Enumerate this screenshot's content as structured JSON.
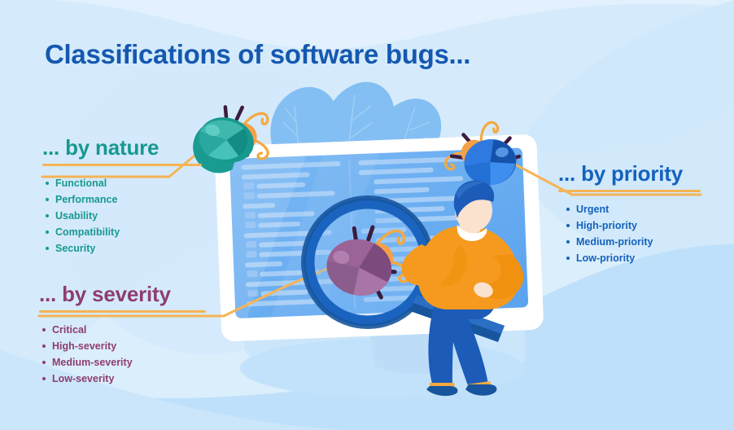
{
  "page": {
    "title": "Classifications of software bugs...",
    "background_color": "#dbeefc",
    "accent_line_color": "#f5b455"
  },
  "sections": {
    "nature": {
      "heading": "... by nature",
      "color": "#17998f",
      "items": [
        "Functional",
        "Performance",
        "Usability",
        "Compatibility",
        "Security"
      ]
    },
    "severity": {
      "heading": "... by severity",
      "color": "#8e3d70",
      "items": [
        "Critical",
        "High-severity",
        "Medium-severity",
        "Low-severity"
      ]
    },
    "priority": {
      "heading": "... by priority",
      "color": "#1462bd",
      "items": [
        "Urgent",
        "High-priority",
        "Medium-priority",
        "Low-priority"
      ]
    }
  },
  "illustration": {
    "monitor": {
      "name": "computer-monitor",
      "screen_color": "#6aaef0"
    },
    "magnifier": {
      "name": "magnifying-glass",
      "color": "#17559e"
    },
    "person": {
      "name": "person-inspecting",
      "sweater_color": "#f59a1e",
      "trousers_color": "#1c5bb8"
    },
    "bugs": [
      {
        "name": "teal-bug",
        "color": "#17998f"
      },
      {
        "name": "blue-bug",
        "color": "#1a63c4"
      },
      {
        "name": "purple-bug",
        "color": "#8e5a8c"
      }
    ]
  }
}
